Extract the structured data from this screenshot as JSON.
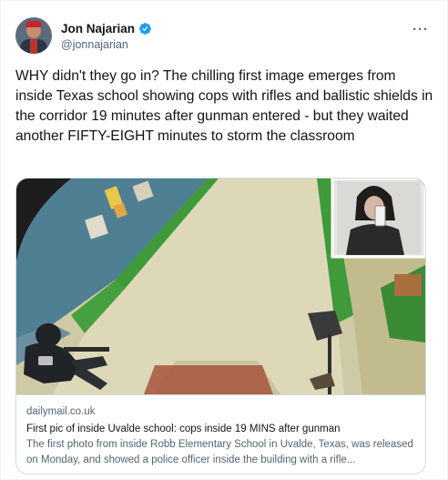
{
  "author": {
    "display_name": "Jon Najarian",
    "handle": "@jonnajarian",
    "verified": true
  },
  "tweet": {
    "text": "WHY didn't they go in? The chilling first image emerges from inside Texas school showing cops with rifles and ballistic shields in the corridor 19 minutes after gunman entered - but they waited another FIFTY-EIGHT minutes to storm the classroom"
  },
  "link_card": {
    "domain": "dailymail.co.uk",
    "title": "First pic of inside Uvalde school: cops inside 19 MINS after gunman",
    "description": "The first photo from inside Robb Elementary School in Uvalde, Texas, was released on Monday, and showed a police officer inside the building with a rifle..."
  },
  "icons": {
    "more": "more-horizontal-icon",
    "verified": "verified-badge-icon"
  },
  "colors": {
    "verified_blue": "#1d9bf0",
    "text_primary": "#0f1419",
    "text_secondary": "#536471",
    "border": "#cfd9de"
  }
}
